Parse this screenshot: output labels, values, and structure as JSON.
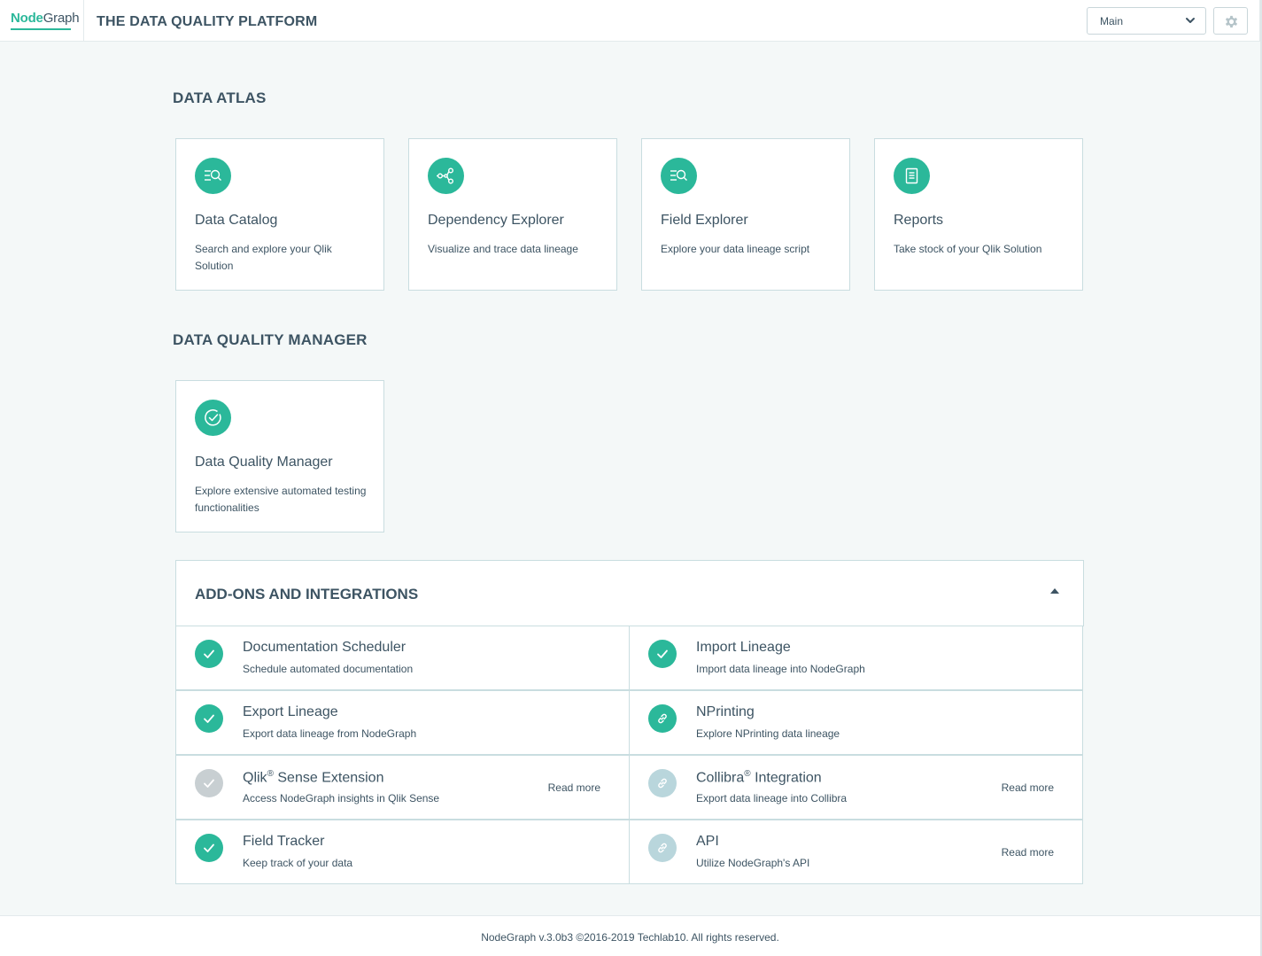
{
  "header": {
    "logo_node": "Node",
    "logo_graph": "Graph",
    "platform_title": "THE DATA QUALITY PLATFORM",
    "environment_select": "Main",
    "settings_icon": "gear-icon"
  },
  "sections": {
    "data_atlas": "DATA ATLAS",
    "data_quality_manager": "DATA QUALITY MANAGER",
    "addons": "ADD-ONS AND INTEGRATIONS"
  },
  "data_atlas_cards": [
    {
      "title": "Data Catalog",
      "desc": "Search and explore your Qlik Solution",
      "icon": "catalog-search-icon"
    },
    {
      "title": "Dependency Explorer",
      "desc": "Visualize and trace data lineage",
      "icon": "lineage-icon"
    },
    {
      "title": "Field Explorer",
      "desc": "Explore your data lineage script",
      "icon": "field-search-icon"
    },
    {
      "title": "Reports",
      "desc": "Take stock of your Qlik Solution",
      "icon": "report-icon"
    }
  ],
  "dqm_cards": [
    {
      "title": "Data Quality Manager",
      "desc": "Explore extensive automated testing functionalities",
      "icon": "check-circle-icon"
    }
  ],
  "addons": [
    {
      "title": "Documentation Scheduler",
      "desc": "Schedule automated documentation",
      "status": "enabled",
      "icon": "check-icon"
    },
    {
      "title": "Import Lineage",
      "desc": "Import data lineage into NodeGraph",
      "status": "enabled",
      "icon": "check-icon"
    },
    {
      "title": "Export Lineage",
      "desc": "Export data lineage from NodeGraph",
      "status": "enabled",
      "icon": "check-icon"
    },
    {
      "title": "NPrinting",
      "desc": "Explore NPrinting data lineage",
      "status": "enabled",
      "icon": "link-icon"
    },
    {
      "title_main": "Qlik",
      "title_sup": "®",
      "title_rest": " Sense Extension",
      "desc": "Access NodeGraph insights in Qlik Sense",
      "status": "disabled",
      "icon": "check-icon",
      "read_more": "Read more"
    },
    {
      "title_main": "Collibra",
      "title_sup": "®",
      "title_rest": " Integration",
      "desc": "Export data lineage into Collibra",
      "status": "disabled",
      "icon": "link-icon",
      "read_more": "Read more"
    },
    {
      "title": "Field Tracker",
      "desc": "Keep track of your data",
      "status": "enabled",
      "icon": "check-icon"
    },
    {
      "title": "API",
      "desc": "Utilize NodeGraph's API",
      "status": "disabled",
      "icon": "link-icon",
      "read_more": "Read more"
    }
  ],
  "footer": {
    "text": "NodeGraph v.3.0b3 ©2016-2019 Techlab10. All rights reserved."
  },
  "colors": {
    "accent": "#2bb89a",
    "text": "#3d5463",
    "disabled_check": "#c8cfd2",
    "disabled_link": "#b9d6dc",
    "background": "#f4f8f8"
  }
}
